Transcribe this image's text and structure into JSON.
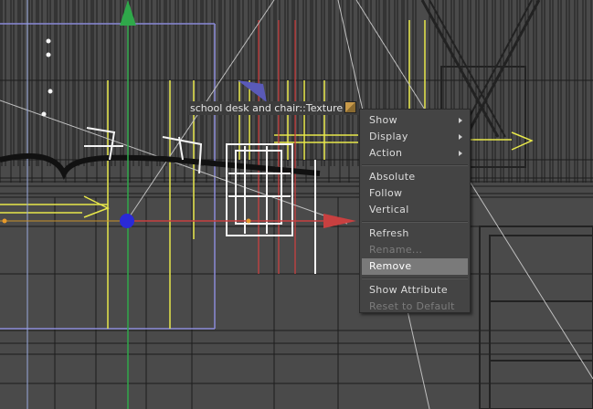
{
  "tooltip": {
    "label": "school desk and chair::Texture",
    "icon": "texture-icon"
  },
  "context_menu": {
    "groups": [
      [
        {
          "label": "Show",
          "submenu": true,
          "enabled": true
        },
        {
          "label": "Display",
          "submenu": true,
          "enabled": true
        },
        {
          "label": "Action",
          "submenu": true,
          "enabled": true
        }
      ],
      [
        {
          "label": "Absolute",
          "enabled": true
        },
        {
          "label": "Follow",
          "enabled": true
        },
        {
          "label": "Vertical",
          "enabled": true
        }
      ],
      [
        {
          "label": "Refresh",
          "enabled": true
        },
        {
          "label": "Rename...",
          "enabled": false
        },
        {
          "label": "Remove",
          "enabled": true,
          "highlighted": true
        }
      ],
      [
        {
          "label": "Show Attribute",
          "enabled": true
        },
        {
          "label": "Reset to Default",
          "enabled": false
        }
      ]
    ]
  },
  "colors": {
    "viewport_bg": "#4a4a4a",
    "grid_line": "#1e1e1e",
    "yellow_guide": "#e8e84a",
    "red_axis": "#c84040",
    "green_axis": "#2fa84a",
    "blue_handle": "#2a2ad8",
    "selection_box": "#8a8ad8"
  }
}
